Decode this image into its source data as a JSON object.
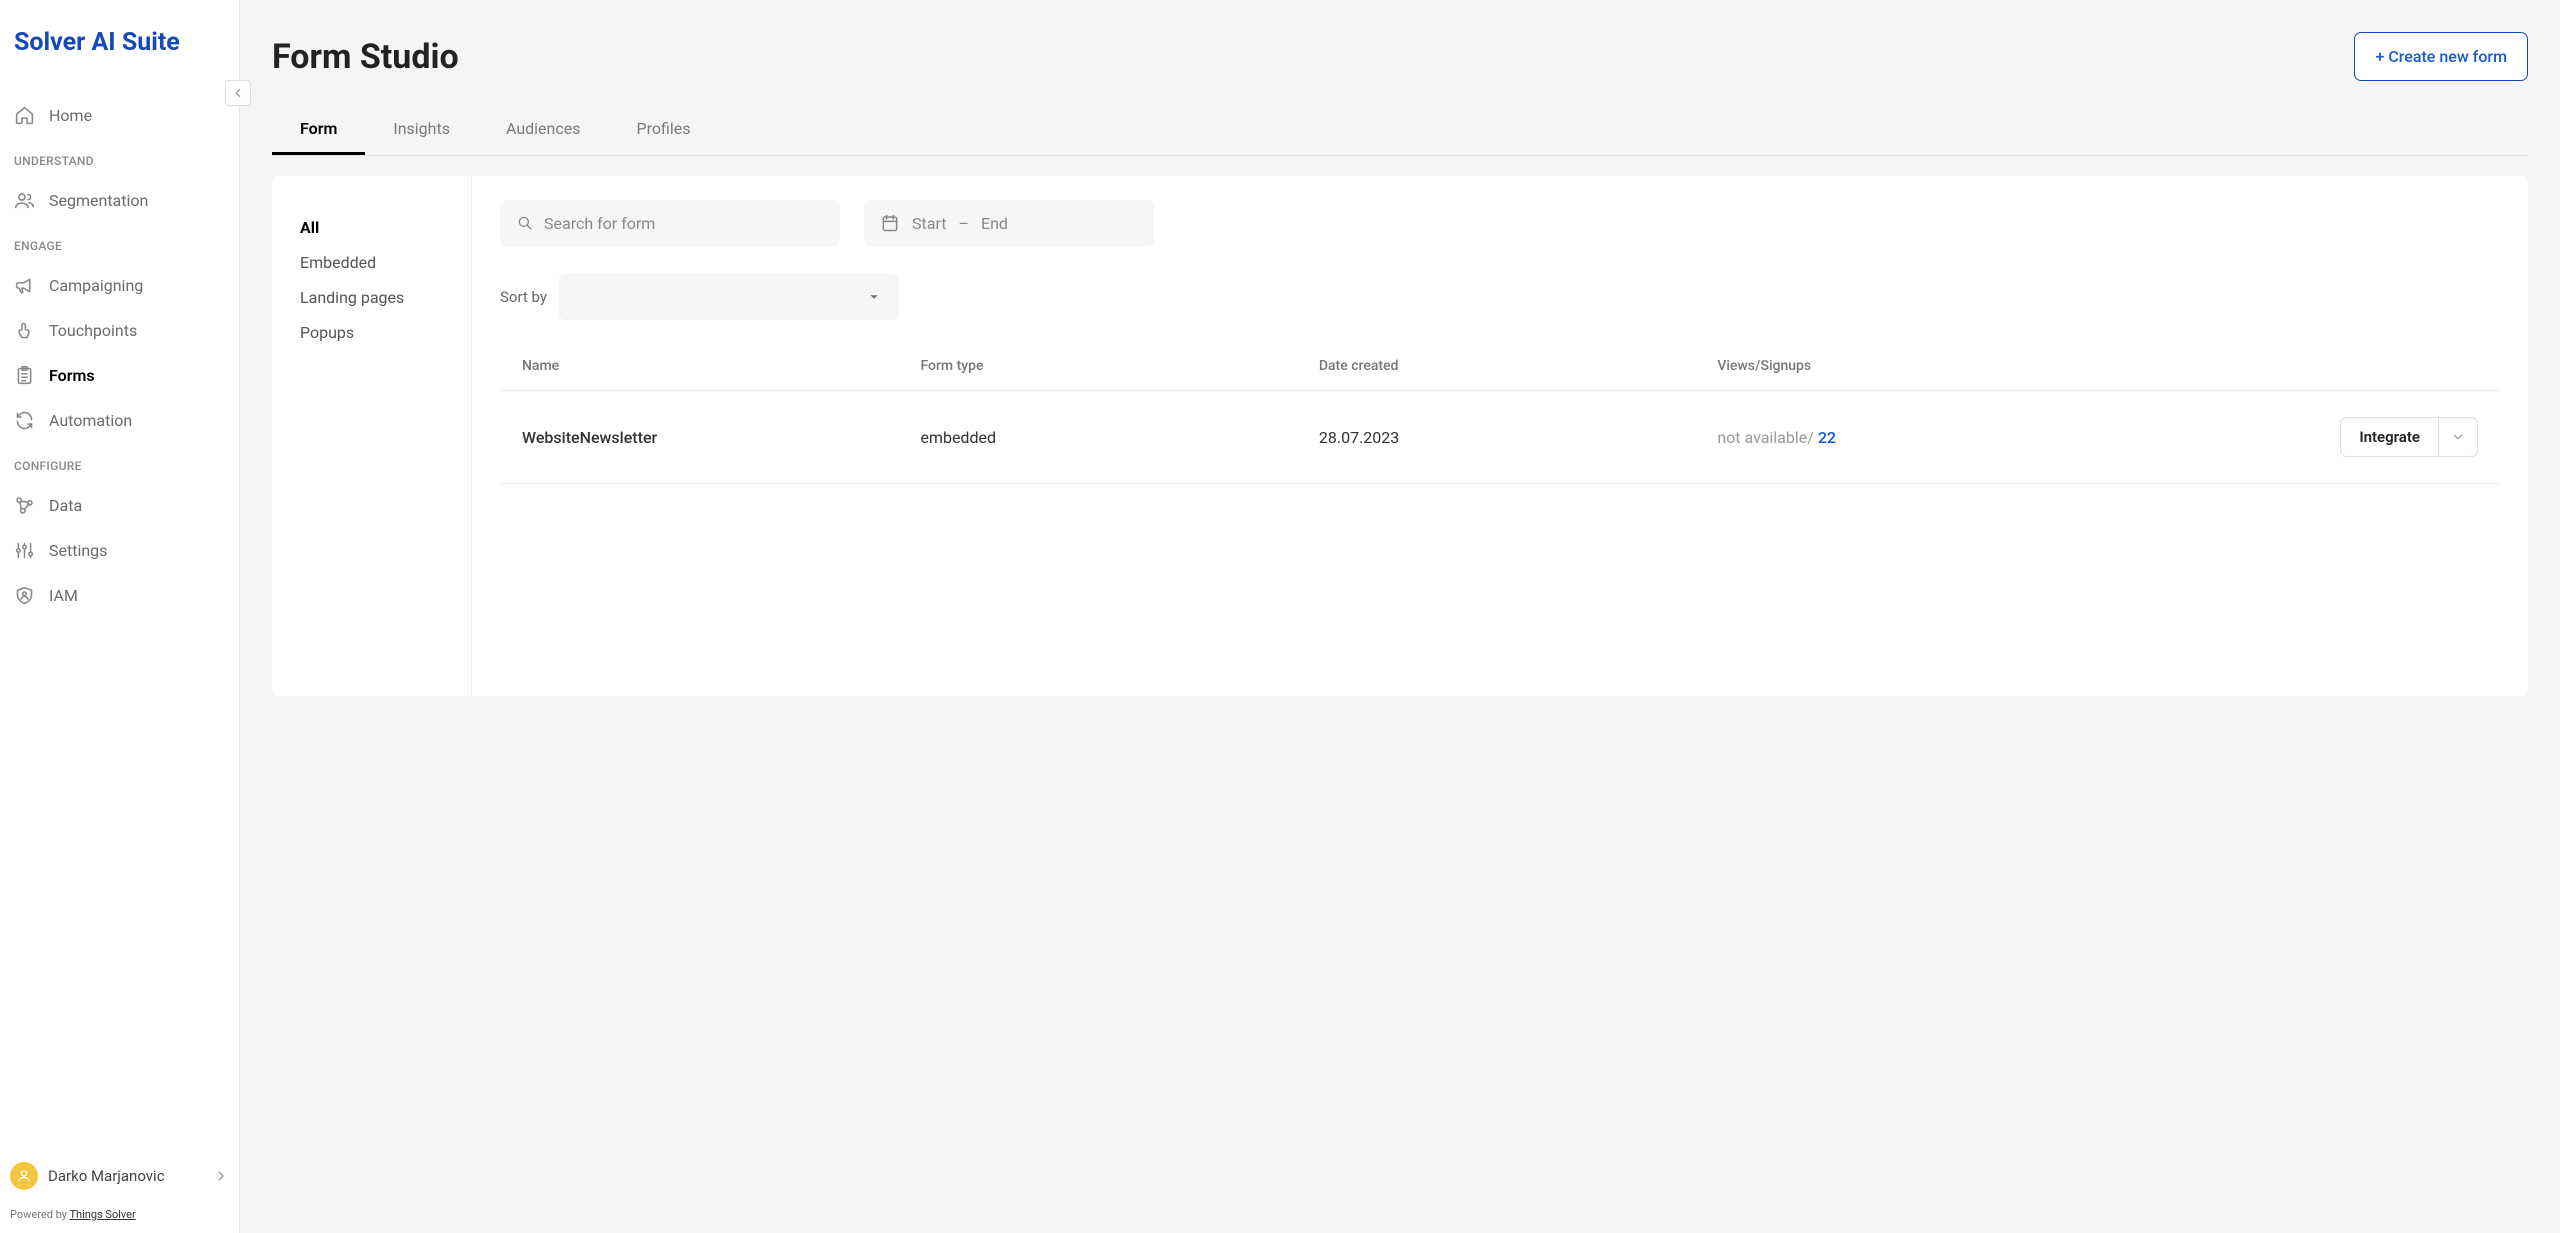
{
  "app_name": "Solver AI Suite",
  "sidebar": {
    "items": [
      {
        "label": "Home"
      },
      {
        "label": "Segmentation"
      },
      {
        "label": "Campaigning"
      },
      {
        "label": "Touchpoints"
      },
      {
        "label": "Forms"
      },
      {
        "label": "Automation"
      },
      {
        "label": "Data"
      },
      {
        "label": "Settings"
      },
      {
        "label": "IAM"
      }
    ],
    "sections": {
      "understand": "UNDERSTAND",
      "engage": "ENGAGE",
      "configure": "CONFIGURE"
    }
  },
  "user": {
    "name": "Darko Marjanovic"
  },
  "footer": {
    "powered_prefix": "Powered by ",
    "powered_link": "Things Solver"
  },
  "page": {
    "title": "Form Studio",
    "create_btn": "+ Create new form"
  },
  "tabs": [
    {
      "label": "Form"
    },
    {
      "label": "Insights"
    },
    {
      "label": "Audiences"
    },
    {
      "label": "Profiles"
    }
  ],
  "filters": [
    {
      "label": "All"
    },
    {
      "label": "Embedded"
    },
    {
      "label": "Landing pages"
    },
    {
      "label": "Popups"
    }
  ],
  "search": {
    "placeholder": "Search for form"
  },
  "daterange": {
    "start": "Start",
    "sep": "–",
    "end": "End"
  },
  "sort": {
    "label": "Sort by"
  },
  "table": {
    "headers": {
      "name": "Name",
      "type": "Form type",
      "date": "Date created",
      "views": "Views/Signups"
    },
    "rows": [
      {
        "name": "WebsiteNewsletter",
        "type": "embedded",
        "date": "28.07.2023",
        "views_text": "not available/ ",
        "views_num": "22",
        "action": "Integrate"
      }
    ]
  }
}
